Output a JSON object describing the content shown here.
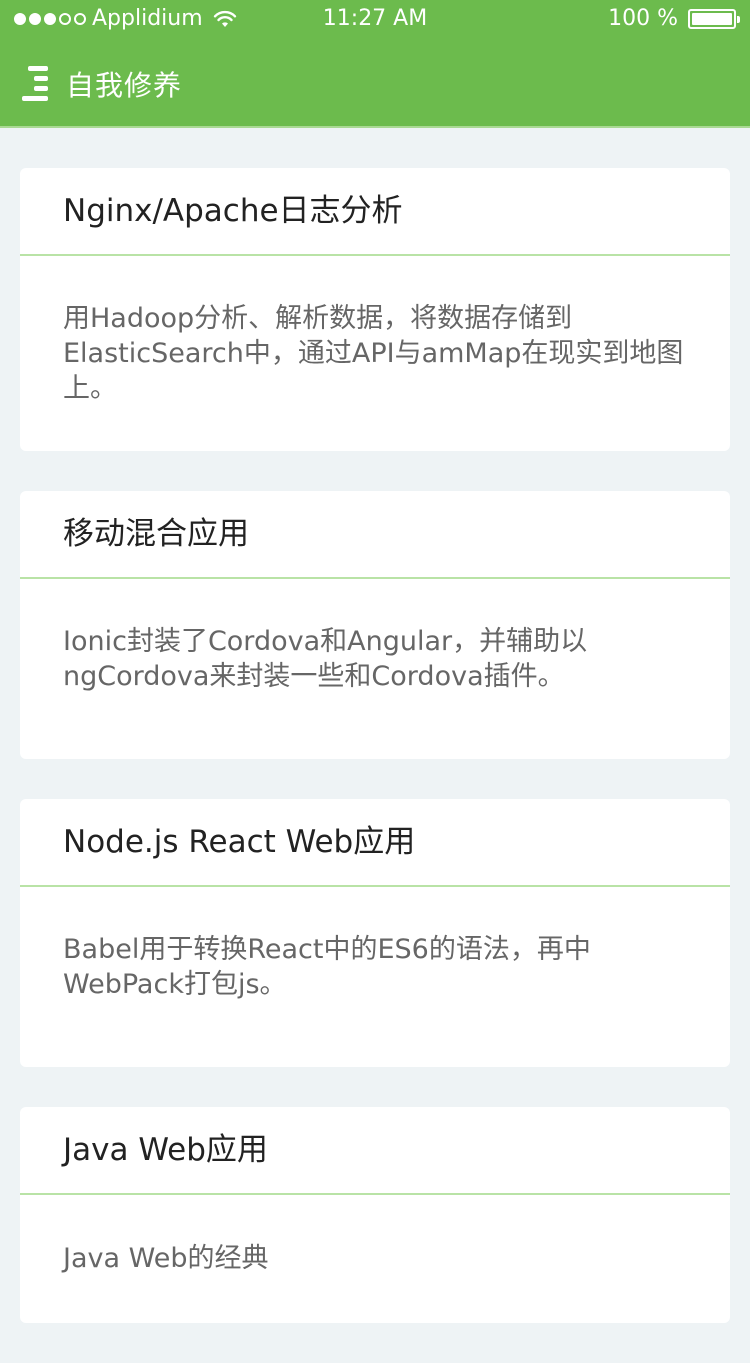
{
  "status_bar": {
    "carrier": "Applidium",
    "time": "11:27 AM",
    "battery": "100 %",
    "signal_bars_filled": 3,
    "signal_bars_total": 5
  },
  "nav": {
    "title": "自我修养",
    "menu_icon": "hamburger-menu-icon"
  },
  "cards": [
    {
      "title": "Nginx/Apache日志分析",
      "body": "用Hadoop分析、解析数据，将数据存储到ElasticSearch中，通过API与amMap在现实到地图上。"
    },
    {
      "title": "移动混合应用",
      "body": "Ionic封装了Cordova和Angular，并辅助以ngCordova来封装一些和Cordova插件。"
    },
    {
      "title": "Node.js React Web应用",
      "body": "Babel用于转换React中的ES6的语法，再中WebPack打包js。"
    },
    {
      "title": "Java Web应用",
      "body": "Java Web的经典"
    }
  ],
  "colors": {
    "header": "#6cbb4d",
    "background": "#eef3f5",
    "divider": "#b9e3a6"
  }
}
